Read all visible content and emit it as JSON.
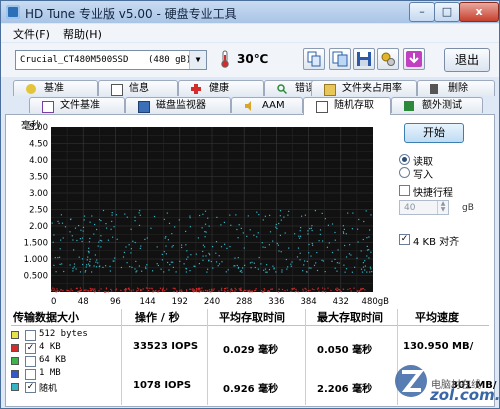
{
  "window": {
    "title": "HD Tune 专业版 v5.00 - 硬盘专业工具",
    "min_label": "–",
    "max_label": "□",
    "close_label": "x"
  },
  "menu": [
    {
      "label": "文件(F)"
    },
    {
      "label": "帮助(H)"
    }
  ],
  "toolbar": {
    "drive_name": "Crucial_CT480M500SSD",
    "drive_size": "(480 gB)",
    "temperature": "30℃",
    "exit_label": "退出",
    "icons": [
      "copy-text-icon",
      "copy-screenshot-icon",
      "save-icon",
      "options-icon",
      "download-icon"
    ]
  },
  "tabs_row1": [
    {
      "label": "基准",
      "icon": "info-icon"
    },
    {
      "label": "信息",
      "icon": "document-icon"
    },
    {
      "label": "健康",
      "icon": "health-cross-icon"
    },
    {
      "label": "错误扫描",
      "icon": "magnifier-icon"
    },
    {
      "label": "文件夹占用率",
      "icon": "folder-icon"
    },
    {
      "label": "删除",
      "icon": "trash-icon"
    }
  ],
  "tabs_row2": [
    {
      "label": "文件基准",
      "icon": "file-benchmark-icon"
    },
    {
      "label": "磁盘监视器",
      "icon": "monitor-icon"
    },
    {
      "label": "AAM",
      "icon": "speaker-icon"
    },
    {
      "label": "随机存取",
      "icon": "random-access-icon",
      "active": true
    },
    {
      "label": "额外测试",
      "icon": "extra-tests-icon"
    }
  ],
  "chart_data": {
    "type": "scatter",
    "ylabel": "毫秒",
    "yticks": [
      "5.00",
      "4.50",
      "4.00",
      "3.50",
      "3.00",
      "2.50",
      "2.00",
      "1.500",
      "1.000",
      "0.500"
    ],
    "xticks": [
      "0",
      "48",
      "96",
      "144",
      "192",
      "240",
      "288",
      "336",
      "384",
      "432",
      "480gB"
    ],
    "xlim": [
      0,
      480
    ],
    "ylim": [
      0,
      5
    ],
    "series": [
      {
        "name": "4 KB",
        "color": "#d42b2b",
        "y_range": [
          0.0,
          0.12
        ]
      },
      {
        "name": "随机",
        "color": "#33b5c8",
        "y_range": [
          0.6,
          2.5
        ]
      }
    ],
    "grid": true,
    "background": "#111111"
  },
  "controls": {
    "start_label": "开始",
    "read_label": "读取",
    "write_label": "写入",
    "read_selected": true,
    "quick_stroke_label": "快捷行程",
    "quick_stroke_checked": false,
    "stroke_value": "40",
    "stroke_unit": "gB",
    "align_label": "4 KB 对齐",
    "align_checked": true
  },
  "table": {
    "headers": [
      "传输数据大小",
      "操作 / 秒",
      "平均存取时间",
      "最大存取时间",
      "平均速度"
    ],
    "rows": [
      {
        "color": "#e8e24a",
        "checked": false,
        "size": "512 bytes",
        "ops": "",
        "avg": "",
        "max": "",
        "speed": ""
      },
      {
        "color": "#d42b2b",
        "checked": true,
        "size": "4 KB",
        "ops": "33523 IOPS",
        "avg": "0.029 毫秒",
        "max": "0.050 毫秒",
        "speed": "130.950 MB/"
      },
      {
        "color": "#3bb44a",
        "checked": false,
        "size": "64 KB",
        "ops": "",
        "avg": "",
        "max": "",
        "speed": ""
      },
      {
        "color": "#3557c8",
        "checked": false,
        "size": "1 MB",
        "ops": "",
        "avg": "",
        "max": "",
        "speed": ""
      },
      {
        "color": "#33b5c8",
        "checked": true,
        "size": "随机",
        "ops": "1078 IOPS",
        "avg": "0.926 毫秒",
        "max": "2.206 毫秒",
        "speed": "301 MB/"
      }
    ]
  },
  "watermark": {
    "line1": "电脑村在线",
    "line2": "zol.com.cn"
  }
}
